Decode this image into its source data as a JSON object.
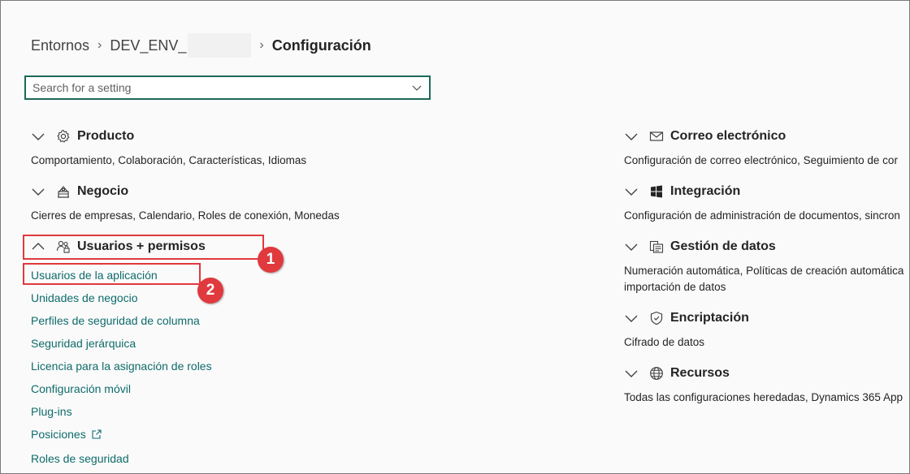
{
  "breadcrumb": {
    "root": "Entornos",
    "environment": "DEV_ENV_",
    "current": "Configuración"
  },
  "search": {
    "placeholder": "Search for a setting",
    "value": ""
  },
  "left_sections": {
    "producto": {
      "title": "Producto",
      "description": "Comportamiento, Colaboración, Características, Idiomas",
      "icon": "gear-icon"
    },
    "negocio": {
      "title": "Negocio",
      "description": "Cierres de empresas, Calendario, Roles de conexión, Monedas",
      "icon": "building-icon"
    },
    "usuarios": {
      "title": "Usuarios + permisos",
      "icon": "users-lock-icon",
      "items": [
        "Usuarios de la aplicación",
        "Unidades de negocio",
        "Perfiles de seguridad de columna",
        "Seguridad jerárquica",
        "Licencia para la asignación de roles",
        "Configuración móvil",
        "Plug-ins",
        "Posiciones",
        "Roles de seguridad"
      ]
    }
  },
  "right_sections": {
    "correo": {
      "title": "Correo electrónico",
      "description": "Configuración de correo electrónico, Seguimiento de cor",
      "icon": "mail-icon"
    },
    "integracion": {
      "title": "Integración",
      "description": "Configuración de administración de documentos, sincron",
      "icon": "windows-icon"
    },
    "gestion": {
      "title": "Gestión de datos",
      "description": "Numeración automática, Políticas de creación automática importación de datos",
      "icon": "data-management-icon"
    },
    "encriptacion": {
      "title": "Encriptación",
      "description": "Cifrado de datos",
      "icon": "shield-icon"
    },
    "recursos": {
      "title": "Recursos",
      "description": "Todas las configuraciones heredadas, Dynamics 365 App",
      "icon": "globe-icon"
    }
  },
  "callouts": {
    "step1": "1",
    "step2": "2"
  },
  "colors": {
    "accent": "#1b6a57",
    "link": "#0f6b6b",
    "callout": "#e0393e"
  }
}
